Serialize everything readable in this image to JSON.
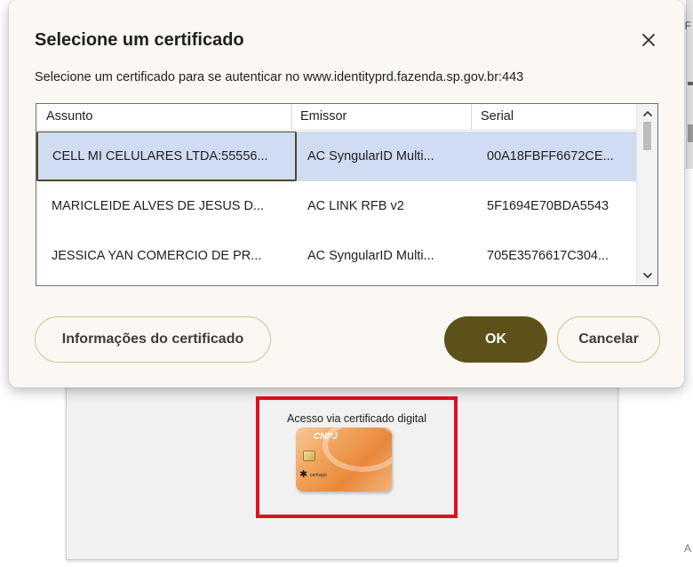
{
  "dialog": {
    "title": "Selecione um certificado",
    "subtitle": "Selecione um certificado para se autenticar no www.identityprd.fazenda.sp.gov.br:443",
    "close_icon": "close-icon",
    "columns": [
      "Assunto",
      "Emissor",
      "Serial"
    ],
    "rows": [
      {
        "subject": "CELL MI CELULARES LTDA:55556...",
        "issuer": "AC SyngularID Multi...",
        "serial": "00A18FBFF6672CE...",
        "selected": true
      },
      {
        "subject": "MARICLEIDE ALVES DE JESUS D...",
        "issuer": "AC LINK RFB v2",
        "serial": "5F1694E70BDA5543",
        "selected": false
      },
      {
        "subject": "JESSICA YAN COMERCIO DE PR...",
        "issuer": "AC SyngularID Multi...",
        "serial": "705E3576617C304...",
        "selected": false
      }
    ],
    "buttons": {
      "info": "Informações do certificado",
      "ok": "OK",
      "cancel": "Cancelar"
    },
    "colors": {
      "accent": "#5c5118",
      "selected_row": "#cfdcf2",
      "dialog_bg": "#fbf8f4"
    }
  },
  "background": {
    "cert_label": "Acesso via certificado digital",
    "card_text": "CNPJ",
    "card_brand": "certisign",
    "highlight_color": "#e3101f",
    "edge_chars": [
      "F",
      "A"
    ]
  }
}
